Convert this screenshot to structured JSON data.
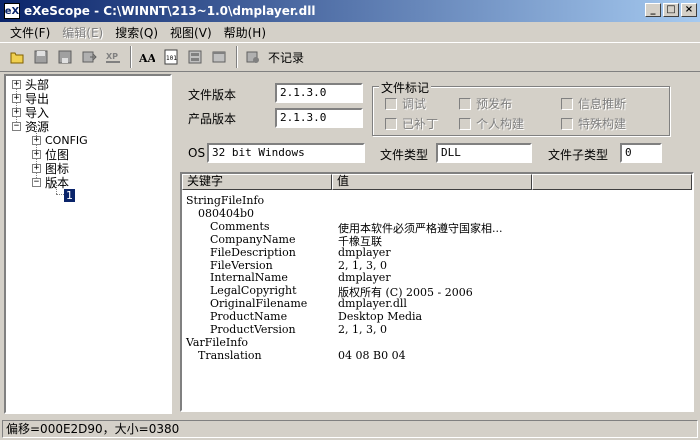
{
  "window": {
    "title": "eXeScope - C:\\WINNT\\213~1.0\\dmplayer.dll",
    "app_icon_text": "eX"
  },
  "menu": [
    {
      "label": "文件(F)",
      "disabled": false
    },
    {
      "label": "编辑(E)",
      "disabled": true
    },
    {
      "label": "搜索(Q)",
      "disabled": false
    },
    {
      "label": "视图(V)",
      "disabled": false
    },
    {
      "label": "帮助(H)",
      "disabled": false
    }
  ],
  "toolbar": {
    "no_record_label": "不记录"
  },
  "tree": {
    "nodes": [
      "头部",
      "导出",
      "导入",
      "资源",
      "CONFIG",
      "位图",
      "图标",
      "版本",
      "1"
    ]
  },
  "version": {
    "file_version_label": "文件版本",
    "file_version": "2.1.3.0",
    "product_version_label": "产品版本",
    "product_version": "2.1.3.0",
    "flags_title": "文件标记",
    "flags": [
      "调试",
      "预发布",
      "信息推断",
      "已补丁",
      "个人构建",
      "特殊构建"
    ],
    "os_label": "OS",
    "os": "32 bit Windows",
    "file_type_label": "文件类型",
    "file_type": "DLL",
    "file_subtype_label": "文件子类型",
    "file_subtype": "0"
  },
  "list": {
    "col_key": "关键字",
    "col_value": "值",
    "rows": [
      {
        "key": "StringFileInfo",
        "value": "",
        "indent": 0
      },
      {
        "key": "080404b0",
        "value": "",
        "indent": 1
      },
      {
        "key": "Comments",
        "value": "使用本软件必须严格遵守国家相...",
        "indent": 2
      },
      {
        "key": "CompanyName",
        "value": "千橡互联",
        "indent": 2
      },
      {
        "key": "FileDescription",
        "value": "dmplayer",
        "indent": 2
      },
      {
        "key": "FileVersion",
        "value": "2, 1, 3, 0",
        "indent": 2
      },
      {
        "key": "InternalName",
        "value": "dmplayer",
        "indent": 2
      },
      {
        "key": "LegalCopyright",
        "value": "版权所有 (C) 2005 - 2006",
        "indent": 2
      },
      {
        "key": "OriginalFilename",
        "value": "dmplayer.dll",
        "indent": 2
      },
      {
        "key": "ProductName",
        "value": "Desktop Media",
        "indent": 2
      },
      {
        "key": "ProductVersion",
        "value": "2, 1, 3, 0",
        "indent": 2
      },
      {
        "key": "VarFileInfo",
        "value": "",
        "indent": 0
      },
      {
        "key": "Translation",
        "value": "04 08 B0 04",
        "indent": 1
      }
    ]
  },
  "status": {
    "text": "偏移=000E2D90，大小=0380"
  }
}
